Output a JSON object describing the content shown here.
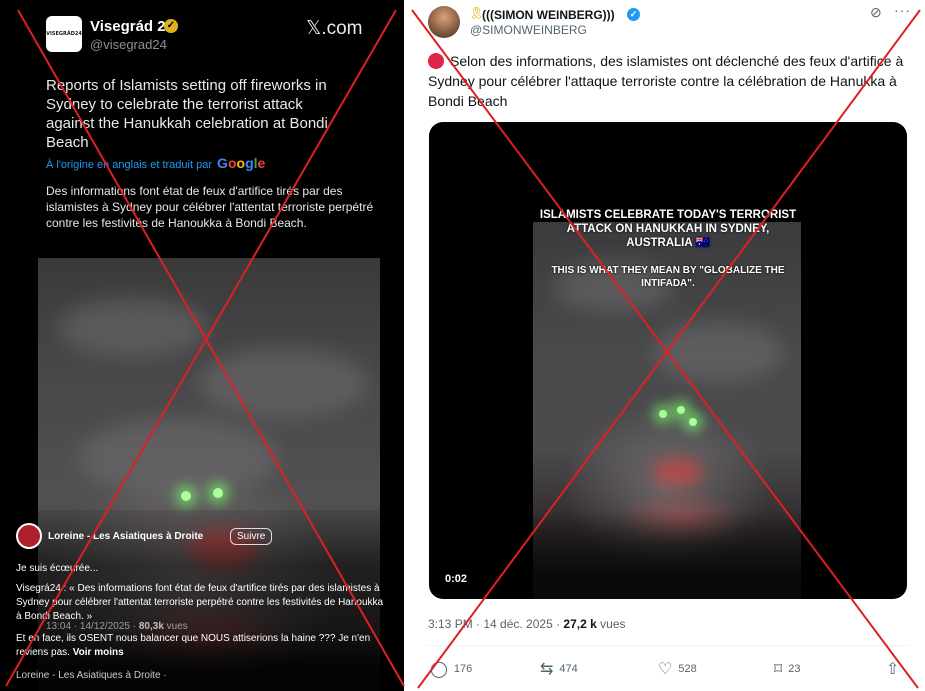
{
  "left_post": {
    "avatar_text": "VISEGRÁD24",
    "account_name": "Visegrád 24",
    "handle": "@visegrad24",
    "brand": "𝕏.com",
    "text_en": "Reports of Islamists setting off fireworks in Sydney to celebrate the terrorist attack against the Hanukkah celebration at Bondi Beach",
    "translated_label": "À l'origine en anglais et traduit par",
    "translated_by": "Google",
    "text_fr": "Des informations font état de feux d'artifice tirés par des islamistes à Sydney pour célébrer l'attentat terroriste perpétré contre les festivités de Hanoukka à Bondi Beach.",
    "overlay": {
      "account_name": "Loreine - Les Asiatiques à Droite",
      "follow_label": "Suivre",
      "line1": "Je suis écœurée...",
      "line2": "Visegrá24 : « Des informations font état de feux d'artifice tirés par des islamistes à Sydney pour célébrer l'attentat terroriste perpétré contre les festivités de Hanoukka à Bondi Beach. »",
      "meta_time": "13:04 · 14/12/2025 ·",
      "meta_views": "80,3k",
      "meta_views_label": "vues",
      "line3": "Et en face, ils OSENT nous balancer que NOUS attiserions la haine ??? Je n'en reviens pas.",
      "more_label": "Voir moins",
      "footer": "Loreine - Les Asiatiques à Droite ·"
    }
  },
  "right_post": {
    "account_name": "(((SIMON WEINBERG)))",
    "handle": "@SIMONWEINBERG",
    "text": "Selon des informations, des islamistes ont déclenché des feux d'artifice à Sydney pour célébrer l'attaque terroriste contre la célébration de Hanukka à Bondi Beach",
    "video_caption_1": "ISLAMISTS CELEBRATE TODAY'S TERRORIST ATTACK ON HANUKKAH IN SYDNEY, AUSTRALIA 🇦🇺",
    "video_caption_2": "THIS IS WHAT THEY MEAN BY \"GLOBALIZE THE INTIFADA\".",
    "duration": "0:02",
    "time": "3:13 PM · 14 déc. 2025 ·",
    "views": "27,2 k",
    "views_label": "vues",
    "stats": {
      "replies": "176",
      "reposts": "474",
      "likes": "528",
      "bookmarks": "23"
    }
  },
  "colors": {
    "cross": "#e02020",
    "link": "#1d9bf0",
    "dark_bg": "#000000",
    "light_bg": "#ffffff"
  },
  "icons": [
    "verified-badge-icon",
    "x-logo-icon",
    "google-logo-icon",
    "ribbon-icon",
    "grok-icon",
    "more-icon",
    "reply-icon",
    "repost-icon",
    "like-icon",
    "bookmark-icon",
    "share-icon"
  ]
}
